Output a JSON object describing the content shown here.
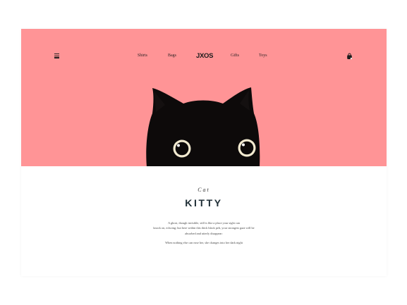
{
  "nav": {
    "menu_icon": "hamburger-menu-icon",
    "links_left": [
      "Shirts",
      "Bags"
    ],
    "brand": "JXOS",
    "links_right": [
      "Gifts",
      "Toys"
    ],
    "cart_icon": "shopping-bag-icon"
  },
  "hero": {
    "background": "#ff9496",
    "illustration": "black-cat-peeking-illustration"
  },
  "content": {
    "eyebrow": "Cat",
    "title": "KITTY",
    "paragraph_lines": [
      "A ghost, though invisible, still is like a place your sight can",
      "knock on, echoing; but here within this thick black pelt, your strongest gaze will be",
      "absorbed and utterly disappear:"
    ],
    "paragraph_2": "When nothing else can ease her, she changes into her dark night"
  },
  "colors": {
    "accent": "#ff9496",
    "title": "#1f2e36",
    "text": "#4a4a4a"
  }
}
